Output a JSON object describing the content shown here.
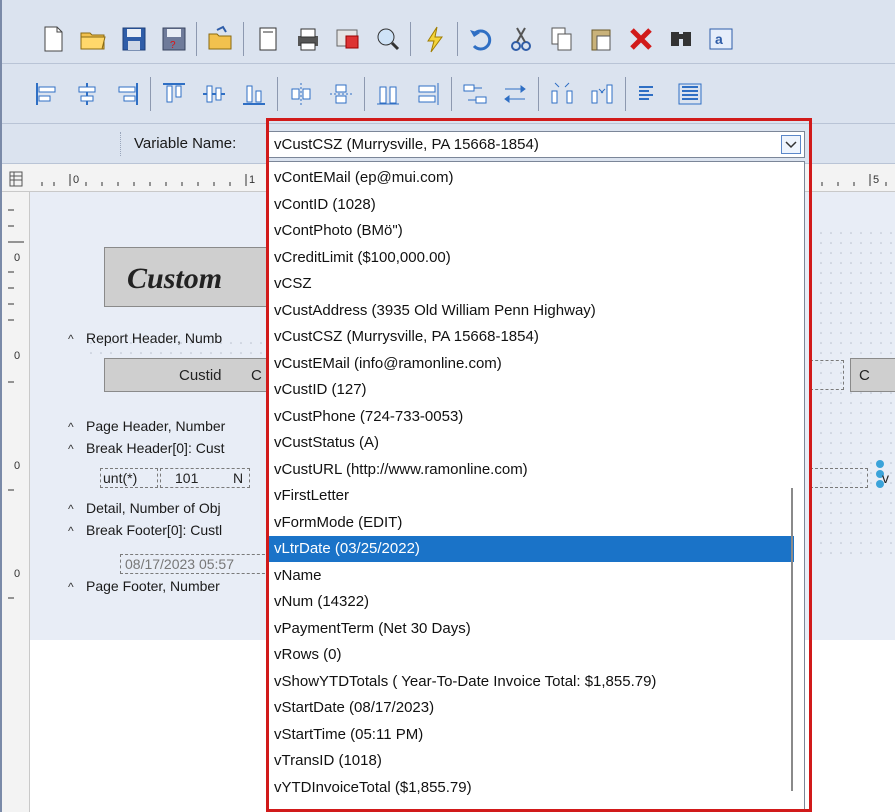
{
  "toolbar1": {
    "buttons": [
      {
        "name": "new-document-icon"
      },
      {
        "name": "open-folder-icon"
      },
      {
        "name": "save-icon"
      },
      {
        "name": "save-as-icon"
      },
      {
        "name": "open-icon"
      },
      {
        "name": "page-icon"
      },
      {
        "name": "print-icon"
      },
      {
        "name": "print-preview-icon"
      },
      {
        "name": "zoom-icon"
      },
      {
        "name": "lightning-icon"
      },
      {
        "name": "undo-icon"
      },
      {
        "name": "cut-icon"
      },
      {
        "name": "copy-icon"
      },
      {
        "name": "paste-icon"
      },
      {
        "name": "delete-icon"
      },
      {
        "name": "find-icon"
      },
      {
        "name": "find-replace-icon"
      }
    ]
  },
  "toolbar2": {
    "buttons": [
      {
        "name": "align-left-icon"
      },
      {
        "name": "align-center-icon"
      },
      {
        "name": "align-right-icon"
      },
      {
        "name": "align-top-icon"
      },
      {
        "name": "align-middle-icon"
      },
      {
        "name": "align-bottom-icon"
      },
      {
        "name": "center-horizontal-icon"
      },
      {
        "name": "center-vertical-icon"
      },
      {
        "name": "same-height-icon"
      },
      {
        "name": "same-width-icon"
      },
      {
        "name": "space-horizontal-icon"
      },
      {
        "name": "space-evenly-icon"
      },
      {
        "name": "increase-spacing-icon"
      },
      {
        "name": "decrease-spacing-icon"
      },
      {
        "name": "bring-forward-icon"
      },
      {
        "name": "send-backward-icon"
      }
    ]
  },
  "varbar": {
    "label": "Variable Name:",
    "selected_value": "vCustCSZ  (Murrysville, PA 15668-1854)"
  },
  "designer": {
    "ruler_marks": [
      "0",
      "1",
      "5"
    ],
    "title_partial": "Custom",
    "bands": [
      {
        "caret": "^",
        "label": "Report Header, Numb"
      },
      {
        "caret": "^",
        "label": "Page Header, Number"
      },
      {
        "caret": "^",
        "label": "Break Header[0]: Cust"
      },
      {
        "caret": "^",
        "label": "Detail, Number of Obj"
      },
      {
        "caret": "^",
        "label": "Break Footer[0]: Custl"
      },
      {
        "caret": "^",
        "label": "Page Footer, Number"
      }
    ],
    "fields": {
      "custid_label": "Custid",
      "custid_label_suffix": "C",
      "right_label": "C",
      "count_expr": "unt(*)",
      "count_value": "101",
      "count_suffix": "N",
      "footer_date": "08/17/2023 05:57",
      "right_field": "v"
    }
  },
  "list": {
    "items": [
      "vContEMail  (ep@mui.com)",
      "vContID  (1028)",
      "vContPhoto  (BMö\")",
      "vCreditLimit  ($100,000.00)",
      "vCSZ",
      "vCustAddress  (3935 Old William Penn Highway)",
      "vCustCSZ  (Murrysville, PA 15668-1854)",
      "vCustEMail  (info@ramonline.com)",
      "vCustID  (127)",
      "vCustPhone  (724-733-0053)",
      "vCustStatus  (A)",
      "vCustURL  (http://www.ramonline.com)",
      "vFirstLetter",
      "vFormMode  (EDIT)",
      "vLtrDate  (03/25/2022)",
      "vName",
      "vNum  (14322)",
      "vPaymentTerm  (Net 30 Days)",
      "vRows  (0)",
      "vShowYTDTotals  ( Year-To-Date Invoice Total:  $1,855.79)",
      "vStartDate  (08/17/2023)",
      "vStartTime  (05:11 PM)",
      "vTransID  (1018)",
      "vYTDInvoiceTotal  ($1,855.79)"
    ],
    "selected_index": 14
  }
}
